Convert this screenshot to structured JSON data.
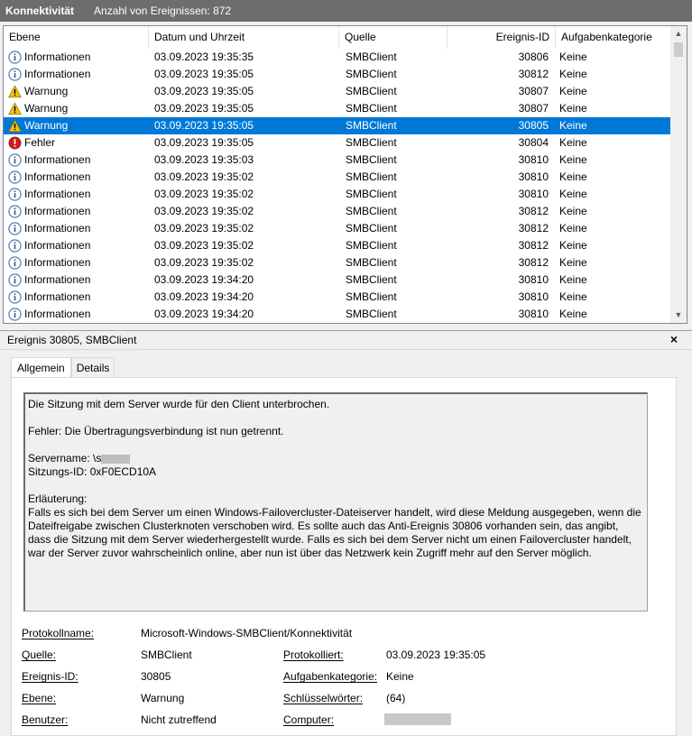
{
  "titlebar": {
    "title": "Konnektivität",
    "count": "Anzahl von Ereignissen: 872"
  },
  "columns": [
    "Ebene",
    "Datum und Uhrzeit",
    "Quelle",
    "Ereignis-ID",
    "Aufgabenkategorie"
  ],
  "rows": [
    {
      "level": "Informationen",
      "icon": "info-icon",
      "date": "03.09.2023 19:35:35",
      "source": "SMBClient",
      "id": "30806",
      "category": "Keine"
    },
    {
      "level": "Informationen",
      "icon": "info-icon",
      "date": "03.09.2023 19:35:05",
      "source": "SMBClient",
      "id": "30812",
      "category": "Keine"
    },
    {
      "level": "Warnung",
      "icon": "warning-icon",
      "date": "03.09.2023 19:35:05",
      "source": "SMBClient",
      "id": "30807",
      "category": "Keine"
    },
    {
      "level": "Warnung",
      "icon": "warning-icon",
      "date": "03.09.2023 19:35:05",
      "source": "SMBClient",
      "id": "30807",
      "category": "Keine"
    },
    {
      "level": "Warnung",
      "icon": "warning-icon",
      "date": "03.09.2023 19:35:05",
      "source": "SMBClient",
      "id": "30805",
      "category": "Keine",
      "selected": true
    },
    {
      "level": "Fehler",
      "icon": "error-icon",
      "date": "03.09.2023 19:35:05",
      "source": "SMBClient",
      "id": "30804",
      "category": "Keine"
    },
    {
      "level": "Informationen",
      "icon": "info-icon",
      "date": "03.09.2023 19:35:03",
      "source": "SMBClient",
      "id": "30810",
      "category": "Keine"
    },
    {
      "level": "Informationen",
      "icon": "info-icon",
      "date": "03.09.2023 19:35:02",
      "source": "SMBClient",
      "id": "30810",
      "category": "Keine"
    },
    {
      "level": "Informationen",
      "icon": "info-icon",
      "date": "03.09.2023 19:35:02",
      "source": "SMBClient",
      "id": "30810",
      "category": "Keine"
    },
    {
      "level": "Informationen",
      "icon": "info-icon",
      "date": "03.09.2023 19:35:02",
      "source": "SMBClient",
      "id": "30812",
      "category": "Keine"
    },
    {
      "level": "Informationen",
      "icon": "info-icon",
      "date": "03.09.2023 19:35:02",
      "source": "SMBClient",
      "id": "30812",
      "category": "Keine"
    },
    {
      "level": "Informationen",
      "icon": "info-icon",
      "date": "03.09.2023 19:35:02",
      "source": "SMBClient",
      "id": "30812",
      "category": "Keine"
    },
    {
      "level": "Informationen",
      "icon": "info-icon",
      "date": "03.09.2023 19:35:02",
      "source": "SMBClient",
      "id": "30812",
      "category": "Keine"
    },
    {
      "level": "Informationen",
      "icon": "info-icon",
      "date": "03.09.2023 19:34:20",
      "source": "SMBClient",
      "id": "30810",
      "category": "Keine"
    },
    {
      "level": "Informationen",
      "icon": "info-icon",
      "date": "03.09.2023 19:34:20",
      "source": "SMBClient",
      "id": "30810",
      "category": "Keine"
    },
    {
      "level": "Informationen",
      "icon": "info-icon",
      "date": "03.09.2023 19:34:20",
      "source": "SMBClient",
      "id": "30810",
      "category": "Keine"
    }
  ],
  "detail": {
    "header": "Ereignis 30805, SMBClient",
    "close": "×",
    "tabs": [
      "Allgemein",
      "Details"
    ],
    "description": {
      "line1": "Die Sitzung mit dem Server wurde für den Client unterbrochen.",
      "line2": "Fehler: Die Übertragungsverbindung ist nun getrennt.",
      "server_label": "Servername: \\s",
      "session": "Sitzungs-ID: 0xF0ECD10A",
      "expl_head": "Erläuterung:",
      "expl_body": "Falls es sich bei dem Server um einen Windows-Failovercluster-Dateiserver handelt, wird diese Meldung ausgegeben, wenn die Dateifreigabe zwischen Clusterknoten verschoben wird. Es sollte auch das Anti-Ereignis 30806 vorhanden sein, das angibt, dass die Sitzung mit dem Server wiederhergestellt wurde. Falls es sich bei dem Server nicht um einen Failovercluster handelt, war der Server zuvor wahrscheinlich online, aber nun ist über das Netzwerk kein Zugriff mehr auf den Server möglich."
    },
    "props": {
      "protokollname_label": "Protokollname:",
      "protokollname": "Microsoft-Windows-SMBClient/Konnektivität",
      "quelle_label": "Quelle:",
      "quelle": "SMBClient",
      "protokolliert_label": "Protokolliert:",
      "protokolliert": "03.09.2023 19:35:05",
      "id_label": "Ereignis-ID:",
      "id": "30805",
      "kategorie_label": "Aufgabenkategorie:",
      "kategorie": "Keine",
      "ebene_label": "Ebene:",
      "ebene": "Warnung",
      "schluessel_label": "Schlüsselwörter:",
      "schluessel": "(64)",
      "benutzer_label": "Benutzer:",
      "benutzer": "Nicht zutreffend",
      "computer_label": "Computer:"
    }
  },
  "scroll": {
    "up": "▲",
    "down": "▼"
  },
  "colors": {
    "selection": "#0078d7",
    "titlebar": "#6d6d6d",
    "info": "#2b6fc0",
    "warning": "#f2c200",
    "error": "#d01c1c"
  }
}
